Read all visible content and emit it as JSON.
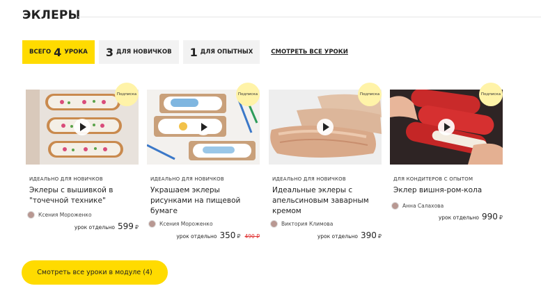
{
  "page": {
    "title": "ЭКЛЕРЫ"
  },
  "filters": {
    "all": {
      "pre": "всего",
      "num": "4",
      "post": "урока"
    },
    "newbies": {
      "num": "3",
      "post": "для новичков"
    },
    "experienced": {
      "num": "1",
      "post": "для опытных"
    },
    "see_all": "смотреть все уроки"
  },
  "badge_text": "Подписка",
  "price_label": "урок отдельно",
  "currency": "₽",
  "cards": [
    {
      "category": "идеально для новичков",
      "title": "Эклеры с вышивкой в \"точечной технике\"",
      "author": "Ксения Мороженко",
      "price": "599",
      "old_price": ""
    },
    {
      "category": "идеально для новичков",
      "title": "Украшаем эклеры рисунками на пищевой бумаге",
      "author": "Ксения Мороженко",
      "price": "350",
      "old_price": "490 ₽"
    },
    {
      "category": "идеально для новичков",
      "title": "Идеальные эклеры с апельсиновым заварным кремом",
      "author": "Виктория Климова",
      "price": "390",
      "old_price": ""
    },
    {
      "category": "для кондитеров с опытом",
      "title": "Эклер вишня-ром-кола",
      "author": "Анна Салахова",
      "price": "990",
      "old_price": ""
    }
  ],
  "cta": "Смотреть все уроки в модуле (4)"
}
